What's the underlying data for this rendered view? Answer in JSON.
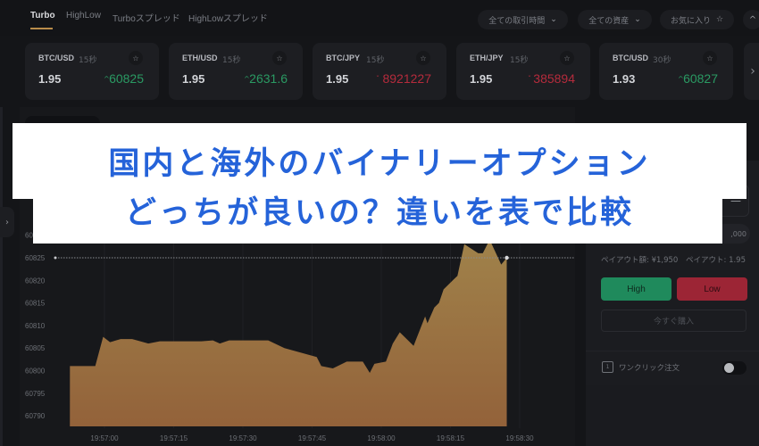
{
  "tabs": [
    {
      "label": "Turbo",
      "active": true
    },
    {
      "label": "HighLow",
      "active": false
    },
    {
      "label": "Turboスプレッド",
      "active": false
    },
    {
      "label": "HighLowスプレッド",
      "active": false
    }
  ],
  "filters": {
    "trade_time": "全ての取引時間",
    "assets": "全ての資産",
    "favorites": "お気に入り",
    "chevron_down_glyph": "⌄",
    "star_glyph": "☆",
    "collapse_glyph": "^"
  },
  "cards": [
    {
      "pair": "BTC/USD",
      "duration": "15秒",
      "payout": "1.95",
      "price": "60825",
      "direction": "up"
    },
    {
      "pair": "ETH/USD",
      "duration": "15秒",
      "payout": "1.95",
      "price": "2631.6",
      "direction": "up"
    },
    {
      "pair": "BTC/JPY",
      "duration": "15秒",
      "payout": "1.95",
      "price": "8921227",
      "direction": "down"
    },
    {
      "pair": "ETH/JPY",
      "duration": "15秒",
      "payout": "1.95",
      "price": "385894",
      "direction": "down"
    },
    {
      "pair": "BTC/USD",
      "duration": "30秒",
      "payout": "1.93",
      "price": "60827",
      "direction": "up"
    }
  ],
  "glyphs": {
    "up_arrow": "^",
    "down_arrow": "ˇ",
    "next": "›",
    "sidebar_toggle": "›",
    "minus": "—"
  },
  "trade_panel": {
    "amount_partial": ",000",
    "payout_amount": "ペイアウト額: ¥1,950",
    "payout_rate": "ペイアウト: 1.95",
    "high_label": "High",
    "low_label": "Low",
    "buy_now_label": "今すぐ購入",
    "one_click_label": "ワンクリック注文",
    "one_click_icon_text": "1",
    "one_click_enabled": false
  },
  "banner": {
    "line1": "国内と海外のバイナリーオプション",
    "line2": "どっちが良いの？違いを表で比較"
  },
  "colors": {
    "accent": "#b98c4a",
    "up": "#2a9a63",
    "down": "#b52b3c",
    "high_button": "#1f8a5c",
    "low_button": "#9c2535",
    "banner_text": "#2563d9",
    "area_top": "#a0824a",
    "area_bottom": "#93623a"
  },
  "chart_data": {
    "type": "area",
    "title": "",
    "xlabel": "",
    "ylabel": "",
    "y_ticks": [
      60830,
      60825,
      60820,
      60815,
      60810,
      60805,
      60800,
      60795,
      60790
    ],
    "y_tick_labels": [
      "60830",
      "60825",
      "60820",
      "60815",
      "60810",
      "60805",
      "60800",
      "60795",
      "60790"
    ],
    "ylim": [
      60788,
      60832
    ],
    "x_tick_labels": [
      "19:57:00",
      "19:57:15",
      "19:57:30",
      "19:57:45",
      "19:58:00",
      "19:58:15",
      "19:58:30"
    ],
    "x_ticks_seconds": [
      0,
      15,
      30,
      45,
      60,
      75,
      90
    ],
    "xlim_seconds": [
      -8.5,
      97
    ],
    "current_price": 60825,
    "series": [
      {
        "name": "BTC/USD",
        "x_seconds": [
          -7.5,
          -2,
          -0.3,
          1.2,
          3.5,
          6,
          9.5,
          12,
          18.5,
          21,
          23.5,
          25,
          27,
          35.5,
          39,
          46,
          47,
          49.5,
          52.5,
          56,
          57.5,
          58.5,
          61,
          62.5,
          64,
          67,
          69.5,
          70,
          71.5,
          72.5,
          73.5,
          76.5,
          78,
          81,
          82,
          83.5,
          86,
          87.2
        ],
        "y_values": [
          60801,
          60801,
          60807.5,
          60806.3,
          60807,
          60807,
          60806,
          60806.5,
          60806.5,
          60806.5,
          60806.7,
          60806,
          60806.7,
          60806.7,
          60805,
          60803,
          60801,
          60800.5,
          60802,
          60802,
          60799.5,
          60801.5,
          60802,
          60806,
          60808.5,
          60805.5,
          60812,
          60810.5,
          60814,
          60815,
          60818,
          60821,
          60828,
          60826,
          60826,
          60829,
          60823.5,
          60825
        ]
      }
    ],
    "grid": true,
    "legend": "none"
  }
}
